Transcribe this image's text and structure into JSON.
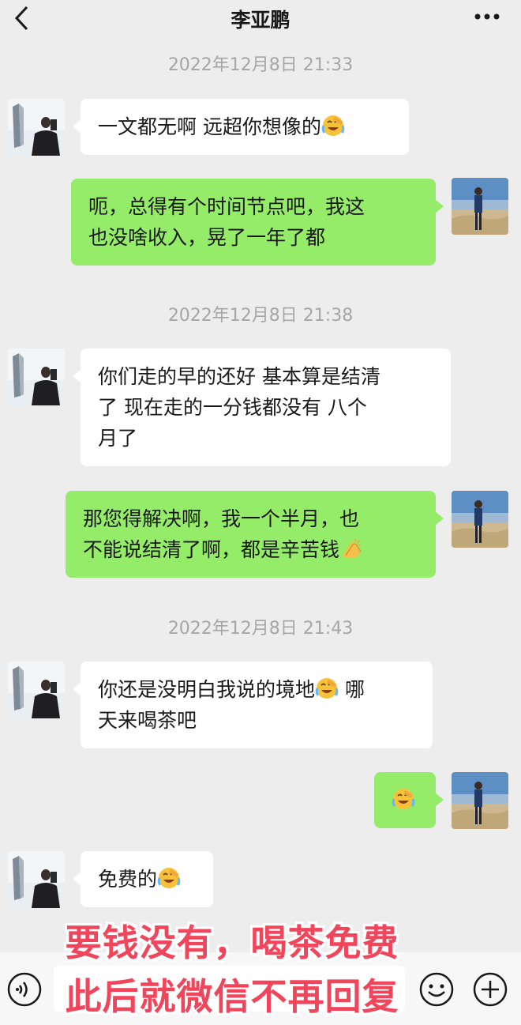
{
  "header": {
    "title": "李亚鹏"
  },
  "messages": [
    {
      "type": "timestamp",
      "text": "2022年12月8日 21:33"
    },
    {
      "type": "in",
      "text": "一文都无啊 远超你想像的",
      "emoji": "facepalm-laugh"
    },
    {
      "type": "out",
      "line1": "呃，总得有个时间节点吧，我这",
      "line2": "也没啥收入，晃了一年了都"
    },
    {
      "type": "timestamp",
      "text": "2022年12月8日 21:38"
    },
    {
      "type": "in",
      "line1": "你们走的早的还好 基本算是结清",
      "line2": "了 现在走的一分钱都没有 八个",
      "line3": "月了"
    },
    {
      "type": "out",
      "line1": "那您得解决啊，我一个半月，也",
      "line2": "不能说结清了啊，都是辛苦钱",
      "emoji": "clapping"
    },
    {
      "type": "timestamp",
      "text": "2022年12月8日 21:43"
    },
    {
      "type": "in",
      "line1": "你还是没明白我说的境地",
      "line1_after": " 哪",
      "line2": "天来喝茶吧",
      "emoji": "facepalm-laugh"
    },
    {
      "type": "out",
      "emoji": "facepalm-laugh"
    },
    {
      "type": "in",
      "text": "免费的",
      "emoji": "facepalm-laugh"
    }
  ],
  "overlay_caption": {
    "line1": "要钱没有，喝茶免费",
    "line2": "此后就微信不再回复"
  },
  "colors": {
    "background": "#ededed",
    "out_bubble": "#95ec69",
    "in_bubble": "#ffffff",
    "caption": "#f0455b"
  }
}
